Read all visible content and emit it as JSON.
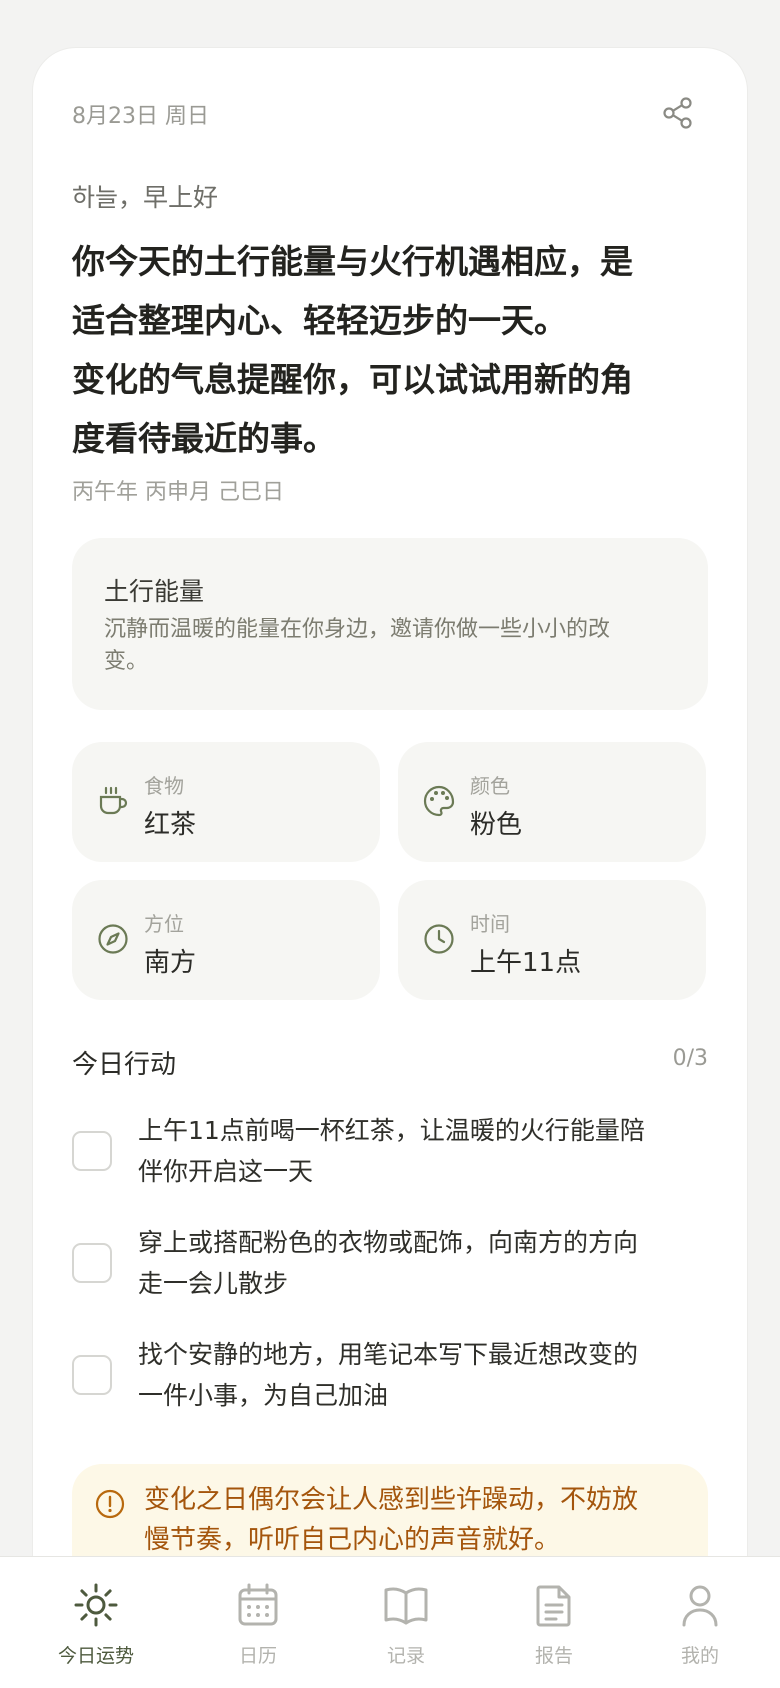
{
  "header": {
    "date": "8月23日 周日",
    "share_icon": "share-icon"
  },
  "greeting": "하늘，早上好",
  "headline": {
    "lines": [
      "你今天的土行能量与火行机遇相应，是",
      "适合整理内心、轻轻迈步的一天。",
      "变化的气息提醒你，可以试试用新的角",
      "度看待最近的事。"
    ]
  },
  "ganzhi": "丙午年 丙申月 己巳日",
  "energy": {
    "title": "土行能量",
    "desc_lines": [
      "沉静而温暖的能量在你身边，邀请你做一些小小的改",
      "变。"
    ]
  },
  "tiles": [
    {
      "label": "食物",
      "value": "红茶",
      "icon": "tea-cup-icon"
    },
    {
      "label": "颜色",
      "value": "粉色",
      "icon": "palette-icon"
    },
    {
      "label": "方位",
      "value": "南方",
      "icon": "compass-icon"
    },
    {
      "label": "时间",
      "value": "上午11点",
      "icon": "clock-icon"
    }
  ],
  "actions": {
    "title": "今日行动",
    "progress": "0/3",
    "items": [
      {
        "lines": [
          "上午11点前喝一杯红茶，让温暖的火行能量陪",
          "伴你开启这一天"
        ],
        "checked": false
      },
      {
        "lines": [
          "穿上或搭配粉色的衣物或配饰，向南方的方向",
          "走一会儿散步"
        ],
        "checked": false
      },
      {
        "lines": [
          "找个安静的地方，用笔记本写下最近想改变的",
          "一件小事，为自己加油"
        ],
        "checked": false
      }
    ]
  },
  "notice": {
    "icon": "alert-circle-icon",
    "lines": [
      "变化之日偶尔会让人感到些许躁动，不妨放",
      "慢节奏，听听自己内心的声音就好。"
    ]
  },
  "tabbar": {
    "items": [
      {
        "label": "今日运势",
        "icon": "sun-icon",
        "active": true
      },
      {
        "label": "日历",
        "icon": "calendar-icon",
        "active": false
      },
      {
        "label": "记录",
        "icon": "book-icon",
        "active": false
      },
      {
        "label": "报告",
        "icon": "document-icon",
        "active": false
      },
      {
        "label": "我的",
        "icon": "person-icon",
        "active": false
      }
    ]
  },
  "colors": {
    "accent": "#5a6b46",
    "notice_text": "#a4550c",
    "notice_bg": "#fdf8e7"
  }
}
